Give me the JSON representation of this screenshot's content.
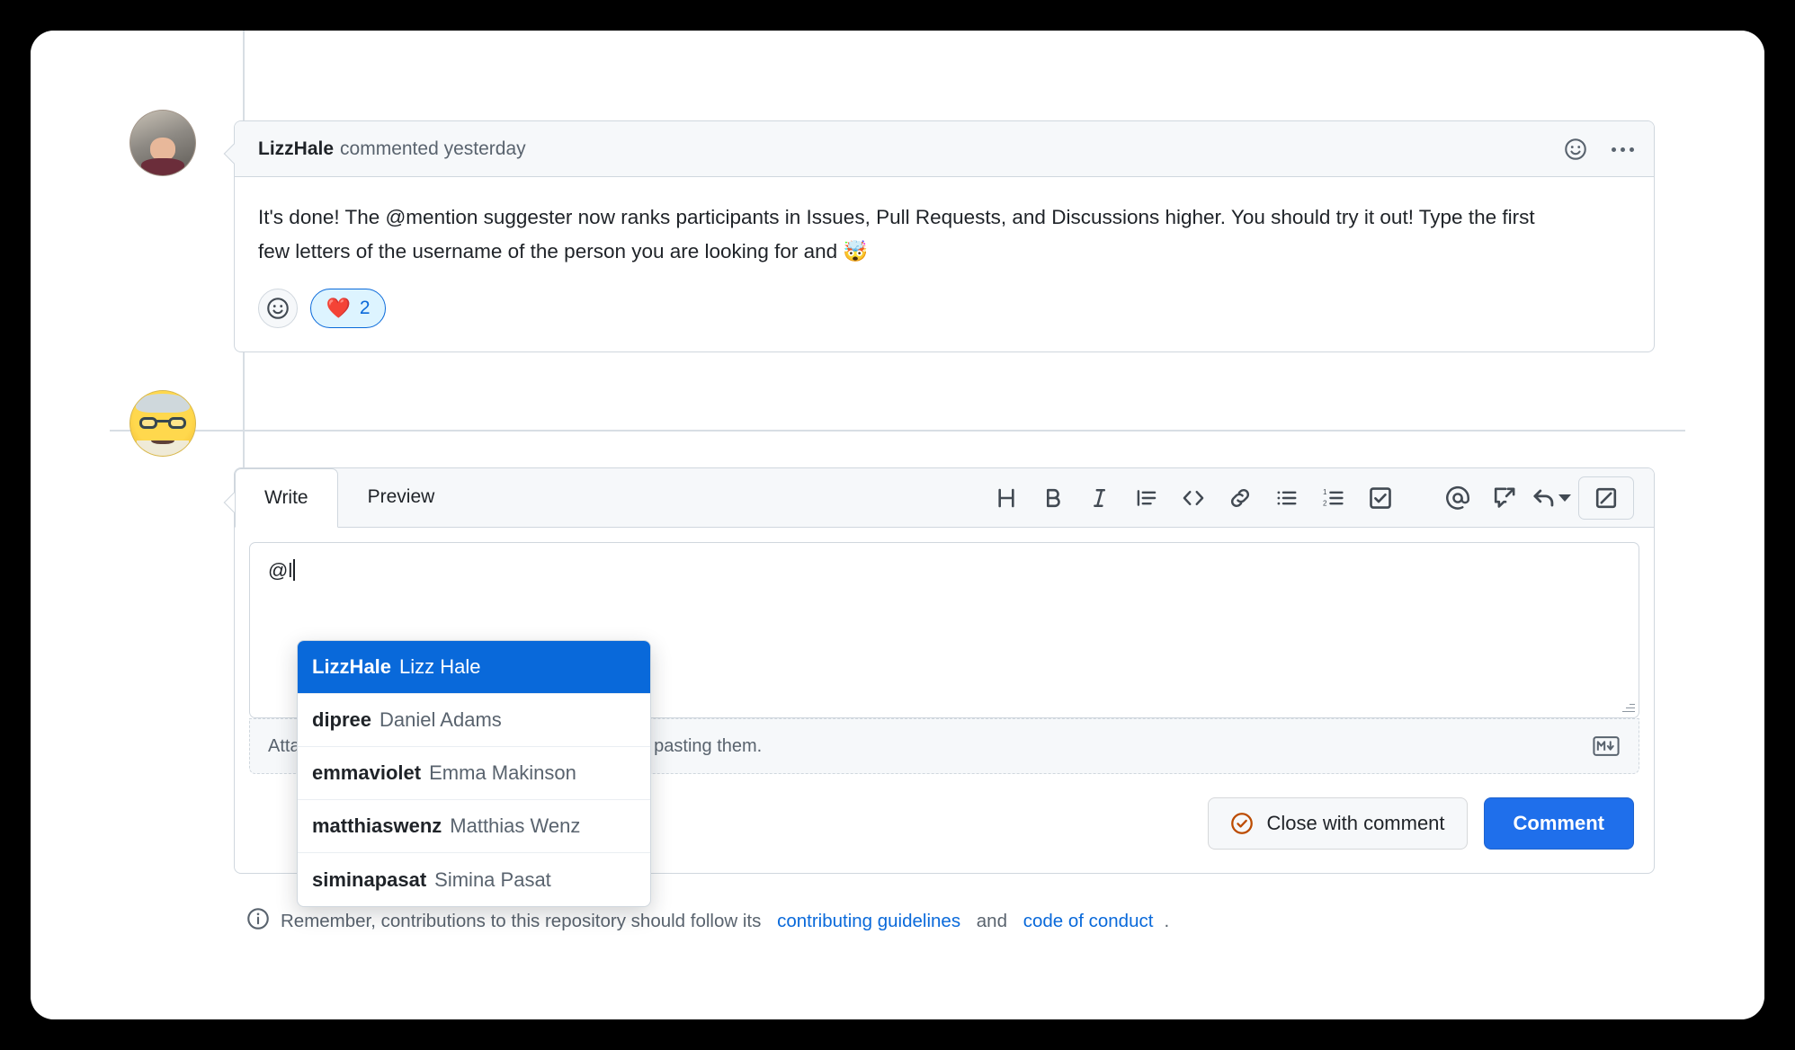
{
  "comment": {
    "author": "LizzHale",
    "meta": "commented yesterday",
    "body_line1": "It's done! The @mention suggester now ranks participants in Issues, Pull Requests, and Discussions higher. You should",
    "body_line2": "try it out! Type the first few letters of the username of the person you are looking for and ",
    "body_emoji": "🤯",
    "actions": {
      "add_reaction": "add-reaction",
      "more_options": "more-options"
    },
    "reactions": [
      {
        "emoji": "❤️",
        "count": "2"
      }
    ]
  },
  "editor": {
    "tabs": [
      {
        "label": "Write",
        "active": true
      },
      {
        "label": "Preview",
        "active": false
      }
    ],
    "toolbar": [
      {
        "name": "heading-icon",
        "glyph": "H"
      },
      {
        "name": "bold-icon",
        "glyph": "B"
      },
      {
        "name": "italic-icon",
        "glyph": "I"
      },
      {
        "name": "quote-icon",
        "glyph": "quote"
      },
      {
        "name": "code-icon",
        "glyph": "<>"
      },
      {
        "name": "link-icon",
        "glyph": "link"
      },
      {
        "name": "unordered-list-icon",
        "glyph": "ul"
      },
      {
        "name": "ordered-list-icon",
        "glyph": "ol"
      },
      {
        "name": "task-list-icon",
        "glyph": "task"
      },
      {
        "name": "mention-icon",
        "glyph": "@"
      },
      {
        "name": "cross-reference-icon",
        "glyph": "xref"
      },
      {
        "name": "saved-reply-icon",
        "glyph": "reply"
      },
      {
        "name": "fullscreen-icon",
        "glyph": "fullscreen"
      }
    ],
    "input_value": "@l",
    "attach_hint_prefix": "At",
    "attach_hint_full": "Attach files by dragging & dropping, selecting or pasting them.",
    "attach_hint_visible_tail": "g, selecting or pasting them.",
    "markdown_badge": "markdown-icon",
    "close_with_comment_label": "Close with comment",
    "comment_label": "Comment"
  },
  "mention_suggestions": [
    {
      "login": "LizzHale",
      "name": "Lizz Hale",
      "selected": true
    },
    {
      "login": "dipree",
      "name": "Daniel Adams",
      "selected": false
    },
    {
      "login": "emmaviolet",
      "name": "Emma Makinson",
      "selected": false
    },
    {
      "login": "matthiaswenz",
      "name": "Matthias Wenz",
      "selected": false
    },
    {
      "login": "siminapasat",
      "name": "Simina Pasat",
      "selected": false
    }
  ],
  "footer": {
    "icon": "info-icon",
    "text_before": "Remember, contributions to this repository should follow its ",
    "link1": "contributing guidelines",
    "text_middle": " and ",
    "link2": "code of conduct",
    "text_after": "."
  },
  "colors": {
    "accent": "#0969da",
    "primary_button": "#1f6feb",
    "border": "#d0d7de",
    "muted_text": "#59636e",
    "text": "#1f2328",
    "surface": "#f6f8fa",
    "reaction_bg": "#ddf4ff",
    "close_icon": "#bc4c00"
  }
}
